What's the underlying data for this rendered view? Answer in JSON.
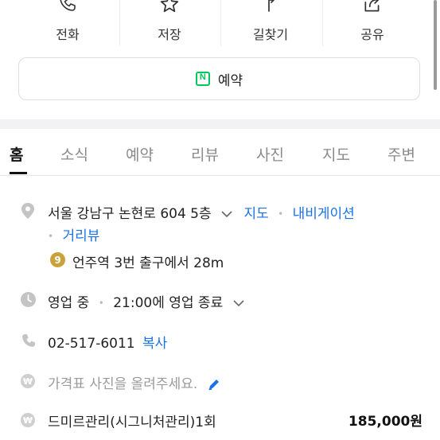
{
  "actions": [
    {
      "label": "전화",
      "icon": "phone-icon"
    },
    {
      "label": "저장",
      "icon": "star-icon"
    },
    {
      "label": "길찾기",
      "icon": "directions-icon"
    },
    {
      "label": "공유",
      "icon": "share-icon"
    }
  ],
  "reserve": {
    "badge": "N",
    "label": "예약"
  },
  "tabs": [
    "홈",
    "소식",
    "예약",
    "리뷰",
    "사진",
    "지도",
    "주변"
  ],
  "address": {
    "text": "서울 강남구 논현로 604 5층",
    "map_link": "지도",
    "navigation_link": "내비게이션",
    "street_view_link": "거리뷰"
  },
  "subway": {
    "line": "9",
    "text": "언주역 3번 출구에서 28m"
  },
  "hours": {
    "status": "영업 중",
    "detail": "21:00에 영업 종료"
  },
  "phone": {
    "number": "02-517-6011",
    "copy_label": "복사"
  },
  "price_photo_prompt": "가격표 사진을 올려주세요.",
  "menu_item": {
    "name": "드미르관리(시그니처관리)1회",
    "price": "185,000원",
    "currency_symbol": "₩"
  },
  "colors": {
    "link": "#1a72e8",
    "naver_green": "#03c75a",
    "subway_line9": "#c9a23a"
  }
}
